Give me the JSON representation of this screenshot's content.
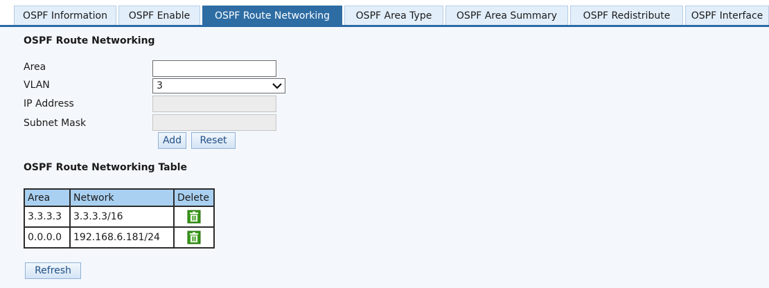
{
  "tabs": [
    {
      "label": "OSPF Information"
    },
    {
      "label": "OSPF Enable"
    },
    {
      "label": "OSPF Route Networking"
    },
    {
      "label": "OSPF Area Type"
    },
    {
      "label": "OSPF Area Summary"
    },
    {
      "label": "OSPF Redistribute"
    },
    {
      "label": "OSPF Interface"
    }
  ],
  "active_tab": "OSPF Route Networking",
  "form": {
    "title": "OSPF Route Networking",
    "area_label": "Area",
    "area_value": "",
    "vlan_label": "VLAN",
    "vlan_value": "3",
    "ip_label": "IP Address",
    "ip_value": "",
    "mask_label": "Subnet Mask",
    "mask_value": "",
    "add_label": "Add",
    "reset_label": "Reset"
  },
  "table": {
    "title": "OSPF Route Networking Table",
    "headers": [
      "Area",
      "Network",
      "Delete"
    ],
    "rows": [
      {
        "area": "3.3.3.3",
        "network": "3.3.3.3/16"
      },
      {
        "area": "0.0.0.0",
        "network": "192.168.6.181/24"
      }
    ],
    "delete_icon": "trash-icon"
  },
  "refresh_label": "Refresh",
  "colors": {
    "tab_active": "#2e6da4",
    "tab_inactive": "#e2eefa",
    "header_cell": "#a9d0f0",
    "trash_icon": "#3a9a1a"
  }
}
